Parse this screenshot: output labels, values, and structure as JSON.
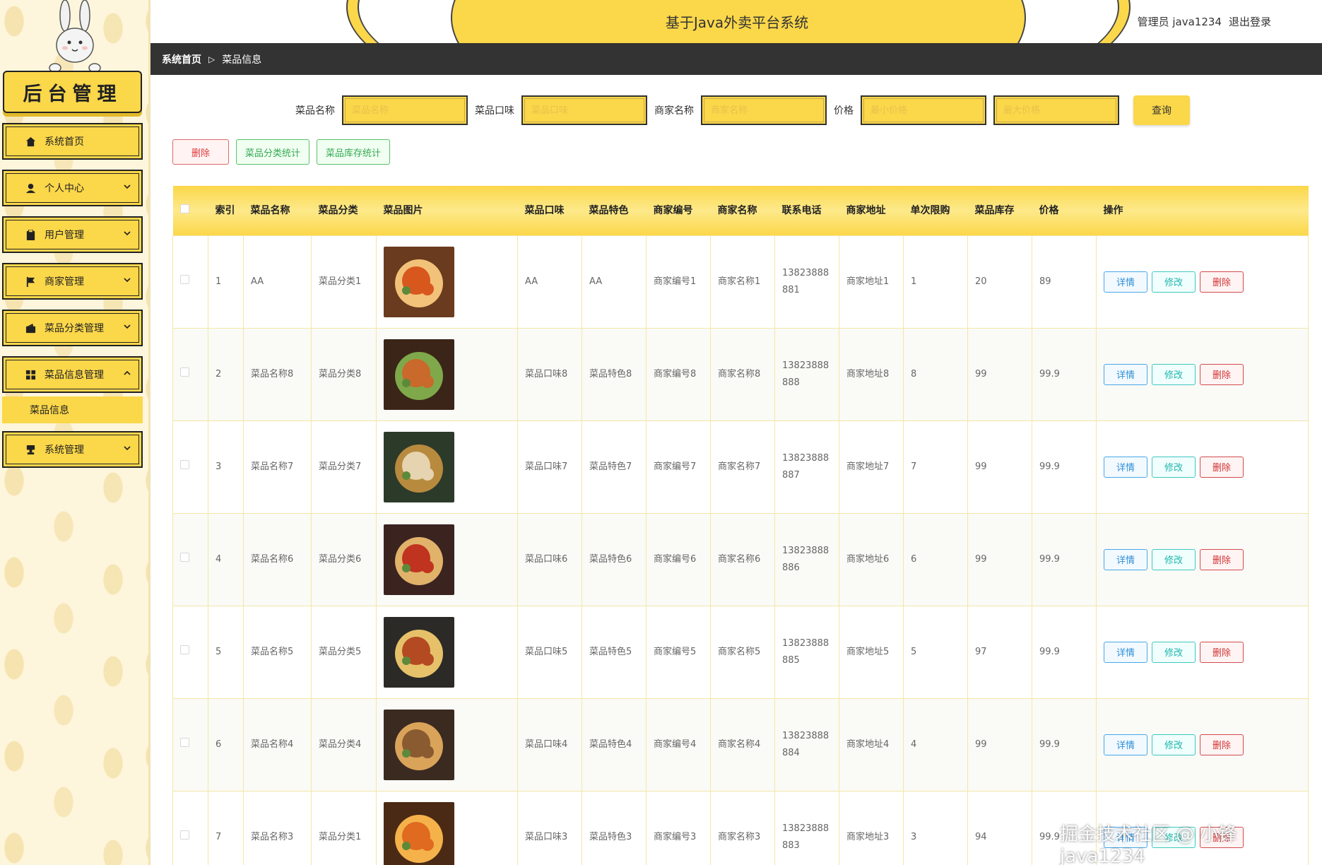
{
  "sidebar": {
    "logo_text": "后台管理",
    "menu": [
      {
        "label": "系统首页",
        "icon": "home-icon",
        "has_chevron": false
      },
      {
        "label": "个人中心",
        "icon": "user-icon",
        "has_chevron": true
      },
      {
        "label": "用户管理",
        "icon": "clipboard-icon",
        "has_chevron": true
      },
      {
        "label": "商家管理",
        "icon": "flag-icon",
        "has_chevron": true
      },
      {
        "label": "菜品分类管理",
        "icon": "wallet-icon",
        "has_chevron": true
      },
      {
        "label": "菜品信息管理",
        "icon": "grid-icon",
        "has_chevron": true,
        "expanded": true
      },
      {
        "label": "系统管理",
        "icon": "stamp-icon",
        "has_chevron": true
      }
    ],
    "submenu_active": "菜品信息"
  },
  "header": {
    "title": "基于Java外卖平台系统",
    "user": "管理员 java1234",
    "logout": "退出登录"
  },
  "breadcrumb": {
    "home": "系统首页",
    "current": "菜品信息"
  },
  "search": {
    "name_label": "菜品名称",
    "name_placeholder": "菜品名称",
    "taste_label": "菜品口味",
    "taste_placeholder": "菜品口味",
    "merchant_label": "商家名称",
    "merchant_placeholder": "商家名称",
    "price_label": "价格",
    "min_price_placeholder": "最小价格",
    "max_price_placeholder": "最大价格",
    "query_label": "查询"
  },
  "actions": {
    "delete": "删除",
    "category_stats": "菜品分类统计",
    "stock_stats": "菜品库存统计"
  },
  "table": {
    "headers": [
      "索引",
      "菜品名称",
      "菜品分类",
      "菜品图片",
      "菜品口味",
      "菜品特色",
      "商家编号",
      "商家名称",
      "联系电话",
      "商家地址",
      "单次限购",
      "菜品库存",
      "价格",
      "操作"
    ],
    "op_detail": "详情",
    "op_edit": "修改",
    "op_delete": "删除",
    "rows": [
      {
        "index": "1",
        "name": "AA",
        "category": "菜品分类1",
        "image": "food-photo-spicy-wings",
        "taste": "AA",
        "feature": "AA",
        "merchant_no": "商家编号1",
        "merchant_name": "商家名称1",
        "phone": "13823888881",
        "address": "商家地址1",
        "limit": "1",
        "stock": "20",
        "price": "89"
      },
      {
        "index": "2",
        "name": "菜品名称8",
        "category": "菜品分类8",
        "image": "food-photo-skewers",
        "taste": "菜品口味8",
        "feature": "菜品特色8",
        "merchant_no": "商家编号8",
        "merchant_name": "商家名称8",
        "phone": "13823888888",
        "address": "商家地址8",
        "limit": "8",
        "stock": "99",
        "price": "99.9"
      },
      {
        "index": "3",
        "name": "菜品名称7",
        "category": "菜品分类7",
        "image": "food-photo-fried-rice",
        "taste": "菜品口味7",
        "feature": "菜品特色7",
        "merchant_no": "商家编号7",
        "merchant_name": "商家名称7",
        "phone": "13823888887",
        "address": "商家地址7",
        "limit": "7",
        "stock": "99",
        "price": "99.9"
      },
      {
        "index": "4",
        "name": "菜品名称6",
        "category": "菜品分类6",
        "image": "food-photo-chili-fish",
        "taste": "菜品口味6",
        "feature": "菜品特色6",
        "merchant_no": "商家编号6",
        "merchant_name": "商家名称6",
        "phone": "13823888886",
        "address": "商家地址6",
        "limit": "6",
        "stock": "99",
        "price": "99.9"
      },
      {
        "index": "5",
        "name": "菜品名称5",
        "category": "菜品分类5",
        "image": "food-photo-feast",
        "taste": "菜品口味5",
        "feature": "菜品特色5",
        "merchant_no": "商家编号5",
        "merchant_name": "商家名称5",
        "phone": "13823888885",
        "address": "商家地址5",
        "limit": "5",
        "stock": "97",
        "price": "99.9"
      },
      {
        "index": "6",
        "name": "菜品名称4",
        "category": "菜品分类4",
        "image": "food-photo-stew",
        "taste": "菜品口味4",
        "feature": "菜品特色4",
        "merchant_no": "商家编号4",
        "merchant_name": "商家名称4",
        "phone": "13823888884",
        "address": "商家地址4",
        "limit": "4",
        "stock": "99",
        "price": "99.9"
      },
      {
        "index": "7",
        "name": "菜品名称3",
        "category": "菜品分类1",
        "image": "food-photo-shrimp",
        "taste": "菜品口味3",
        "feature": "菜品特色3",
        "merchant_no": "商家编号3",
        "merchant_name": "商家名称3",
        "phone": "13823888883",
        "address": "商家地址3",
        "limit": "3",
        "stock": "94",
        "price": "99.9"
      }
    ]
  },
  "watermark": "掘金技术社区 @ 小锋java1234",
  "colors": {
    "accent": "#fbd74a",
    "dark": "#333333",
    "delete": "#d23333",
    "detail": "#2f8fd6",
    "edit": "#1fb5ad",
    "green": "#34a853"
  }
}
